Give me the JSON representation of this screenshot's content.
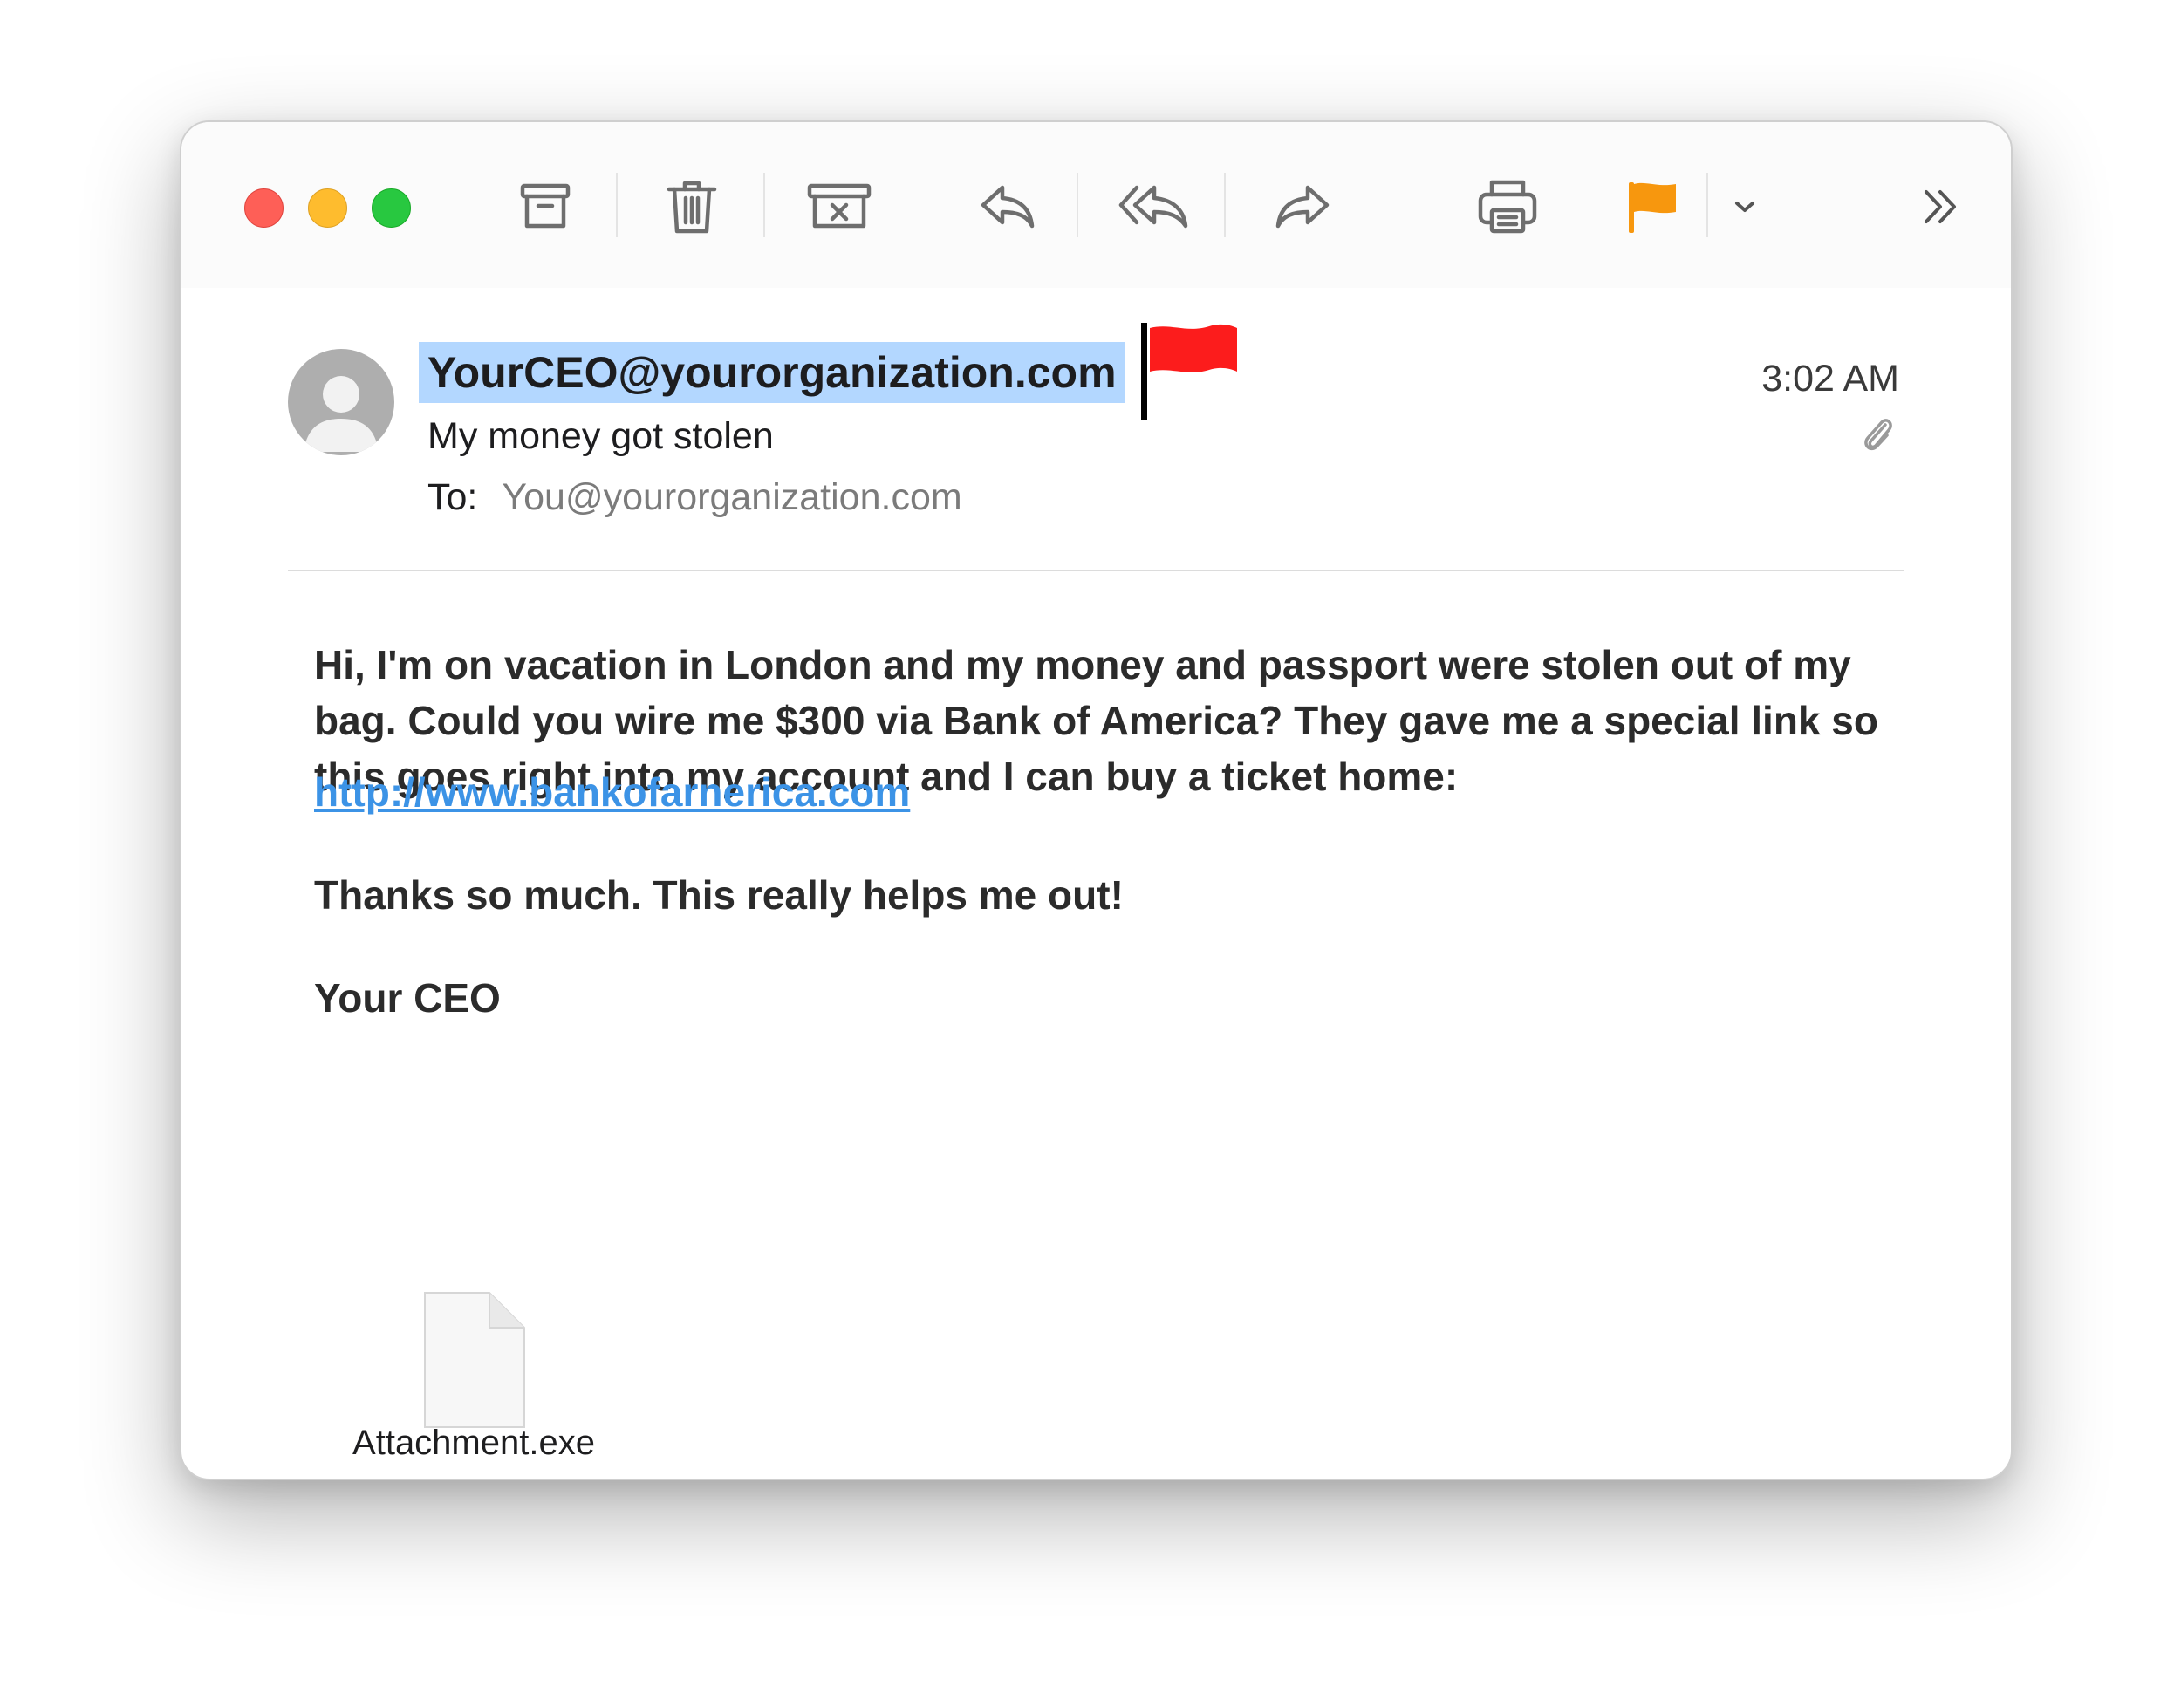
{
  "toolbar": {
    "buttons": [
      {
        "name": "archive",
        "icon": "archive-box-icon"
      },
      {
        "name": "delete",
        "icon": "trash-icon"
      },
      {
        "name": "junk",
        "icon": "junk-box-icon"
      },
      {
        "name": "reply",
        "icon": "reply-arrow-icon"
      },
      {
        "name": "reply-all",
        "icon": "reply-all-arrow-icon"
      },
      {
        "name": "forward",
        "icon": "forward-arrow-icon"
      },
      {
        "name": "print",
        "icon": "printer-icon"
      },
      {
        "name": "flag",
        "icon": "orange-flag-icon"
      },
      {
        "name": "flag-menu",
        "icon": "chevron-down-icon"
      },
      {
        "name": "more",
        "icon": "double-chevron-right-icon"
      }
    ],
    "flag_color": "#f7970e"
  },
  "message": {
    "sender": "YourCEO@yourorganization.com",
    "subject": "My money got stolen",
    "to_label": "To:",
    "to_value": "You@yourorganization.com",
    "time": "3:02 AM",
    "body_para1": "Hi, I'm on vacation in London and my money and passport were stolen out of my bag. Could you wire me $300 via Bank of America? They gave me a special link so this goes right into my account and I can buy a ticket home:",
    "link": "http://www.bankofarnerica.com",
    "body_para2": "Thanks so much. This really helps me out!",
    "signature": "Your CEO",
    "attachment_name": "Attachment.exe"
  },
  "colors": {
    "selection_highlight": "#b3d7ff",
    "link_color": "#3c93e6",
    "red_flag": "#fc1c1c",
    "close": "#fe5f57",
    "minimize": "#febc2e",
    "maximize": "#28c840"
  }
}
